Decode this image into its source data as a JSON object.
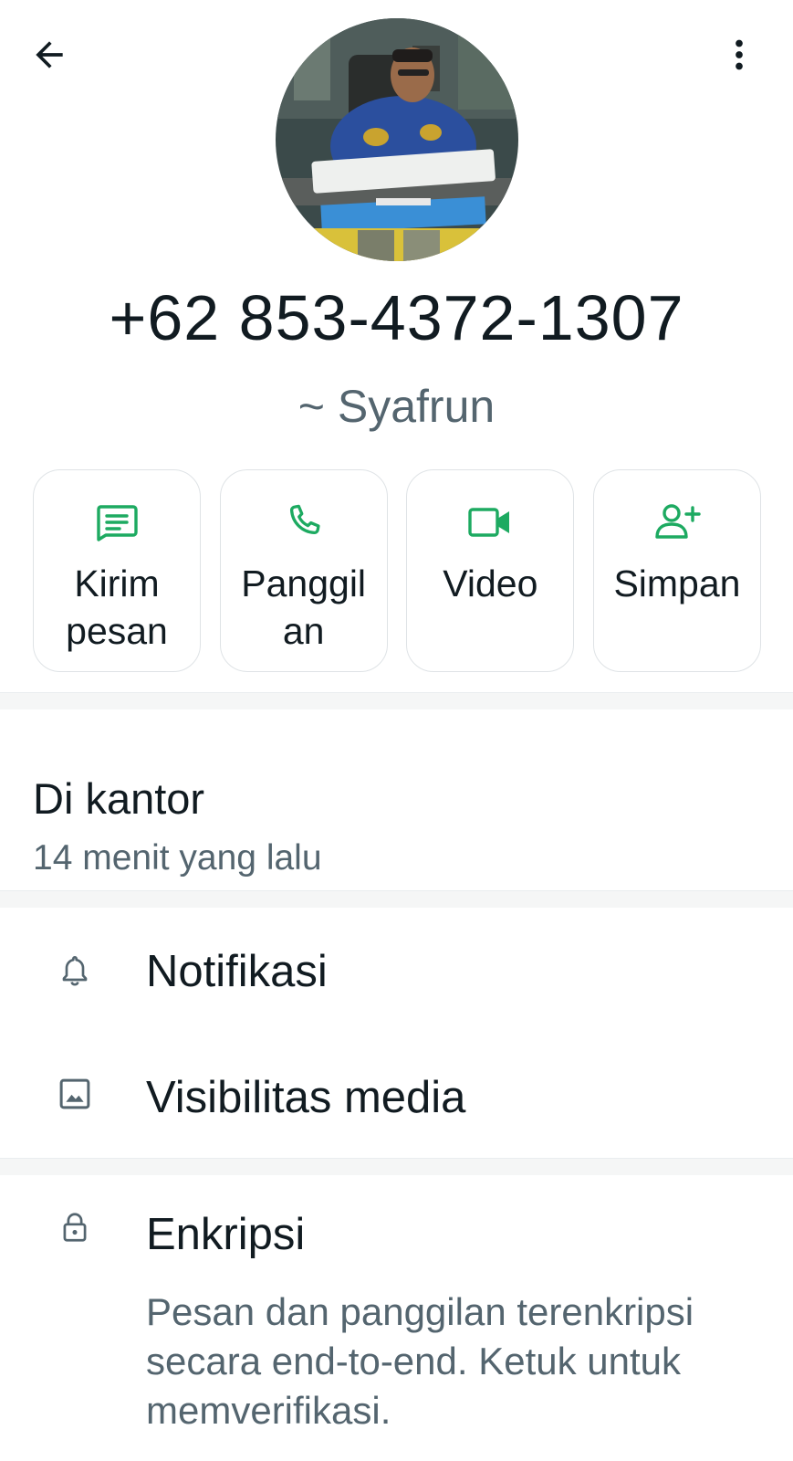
{
  "header": {
    "back_icon": "arrow-left-icon",
    "menu_icon": "more-vertical-icon"
  },
  "profile": {
    "phone": "+62 853-4372-1307",
    "name": "~ Syafrun"
  },
  "actions": [
    {
      "label": "Kirim\npesan",
      "icon": "message-icon"
    },
    {
      "label": "Panggil\nan",
      "icon": "phone-icon"
    },
    {
      "label": "Video",
      "icon": "video-icon"
    },
    {
      "label": "Simpan",
      "icon": "add-contact-icon"
    }
  ],
  "about": {
    "status": "Di kantor",
    "time": "14 menit yang lalu"
  },
  "settings": {
    "notifications": "Notifikasi",
    "media_visibility": "Visibilitas media"
  },
  "encryption": {
    "title": "Enkripsi",
    "description": "Pesan dan panggilan terenkripsi secara end-to-end. Ketuk untuk memverifikasi."
  },
  "colors": {
    "accent": "#1daa61",
    "text_primary": "#111b21",
    "text_secondary": "#54656f",
    "divider": "#f5f6f6"
  }
}
